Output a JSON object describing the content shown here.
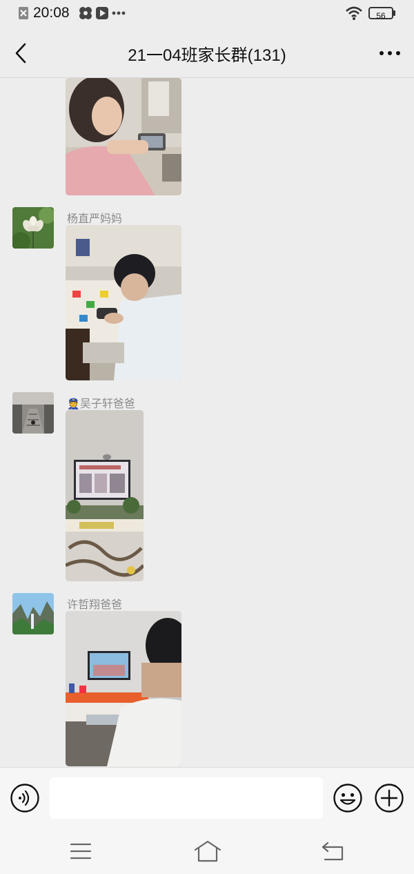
{
  "status_bar": {
    "time": "20:08",
    "battery": "56",
    "icons": [
      "notification-icon",
      "pinwheel-icon",
      "play-icon",
      "more-dots-icon",
      "wifi-icon",
      "battery-icon"
    ]
  },
  "header": {
    "title": "21一04班家长群(131)",
    "back_icon": "chevron-left-icon",
    "more_icon": "more-horizontal-icon"
  },
  "messages": [
    {
      "sender": "",
      "content": "photo",
      "photo_desc": "girl-holding-tablet"
    },
    {
      "sender": "杨直严妈妈",
      "content": "photo",
      "avatar": "lotus-flower",
      "photo_desc": "boy-at-desk-with-phone"
    },
    {
      "sender": "吴子轩爸爸",
      "sender_emoji": "👮",
      "content": "photo",
      "avatar": "stairway-street",
      "photo_desc": "living-room-tv"
    },
    {
      "sender": "许哲翔爸爸",
      "content": "photo",
      "avatar": "mountain-landscape",
      "photo_desc": "man-watching-tv"
    }
  ],
  "input_bar": {
    "voice_icon": "voice-icon",
    "emoji_icon": "emoji-icon",
    "plus_icon": "plus-icon",
    "value": ""
  },
  "system_nav": {
    "icons": [
      "menu-icon",
      "home-icon",
      "back-icon"
    ]
  }
}
